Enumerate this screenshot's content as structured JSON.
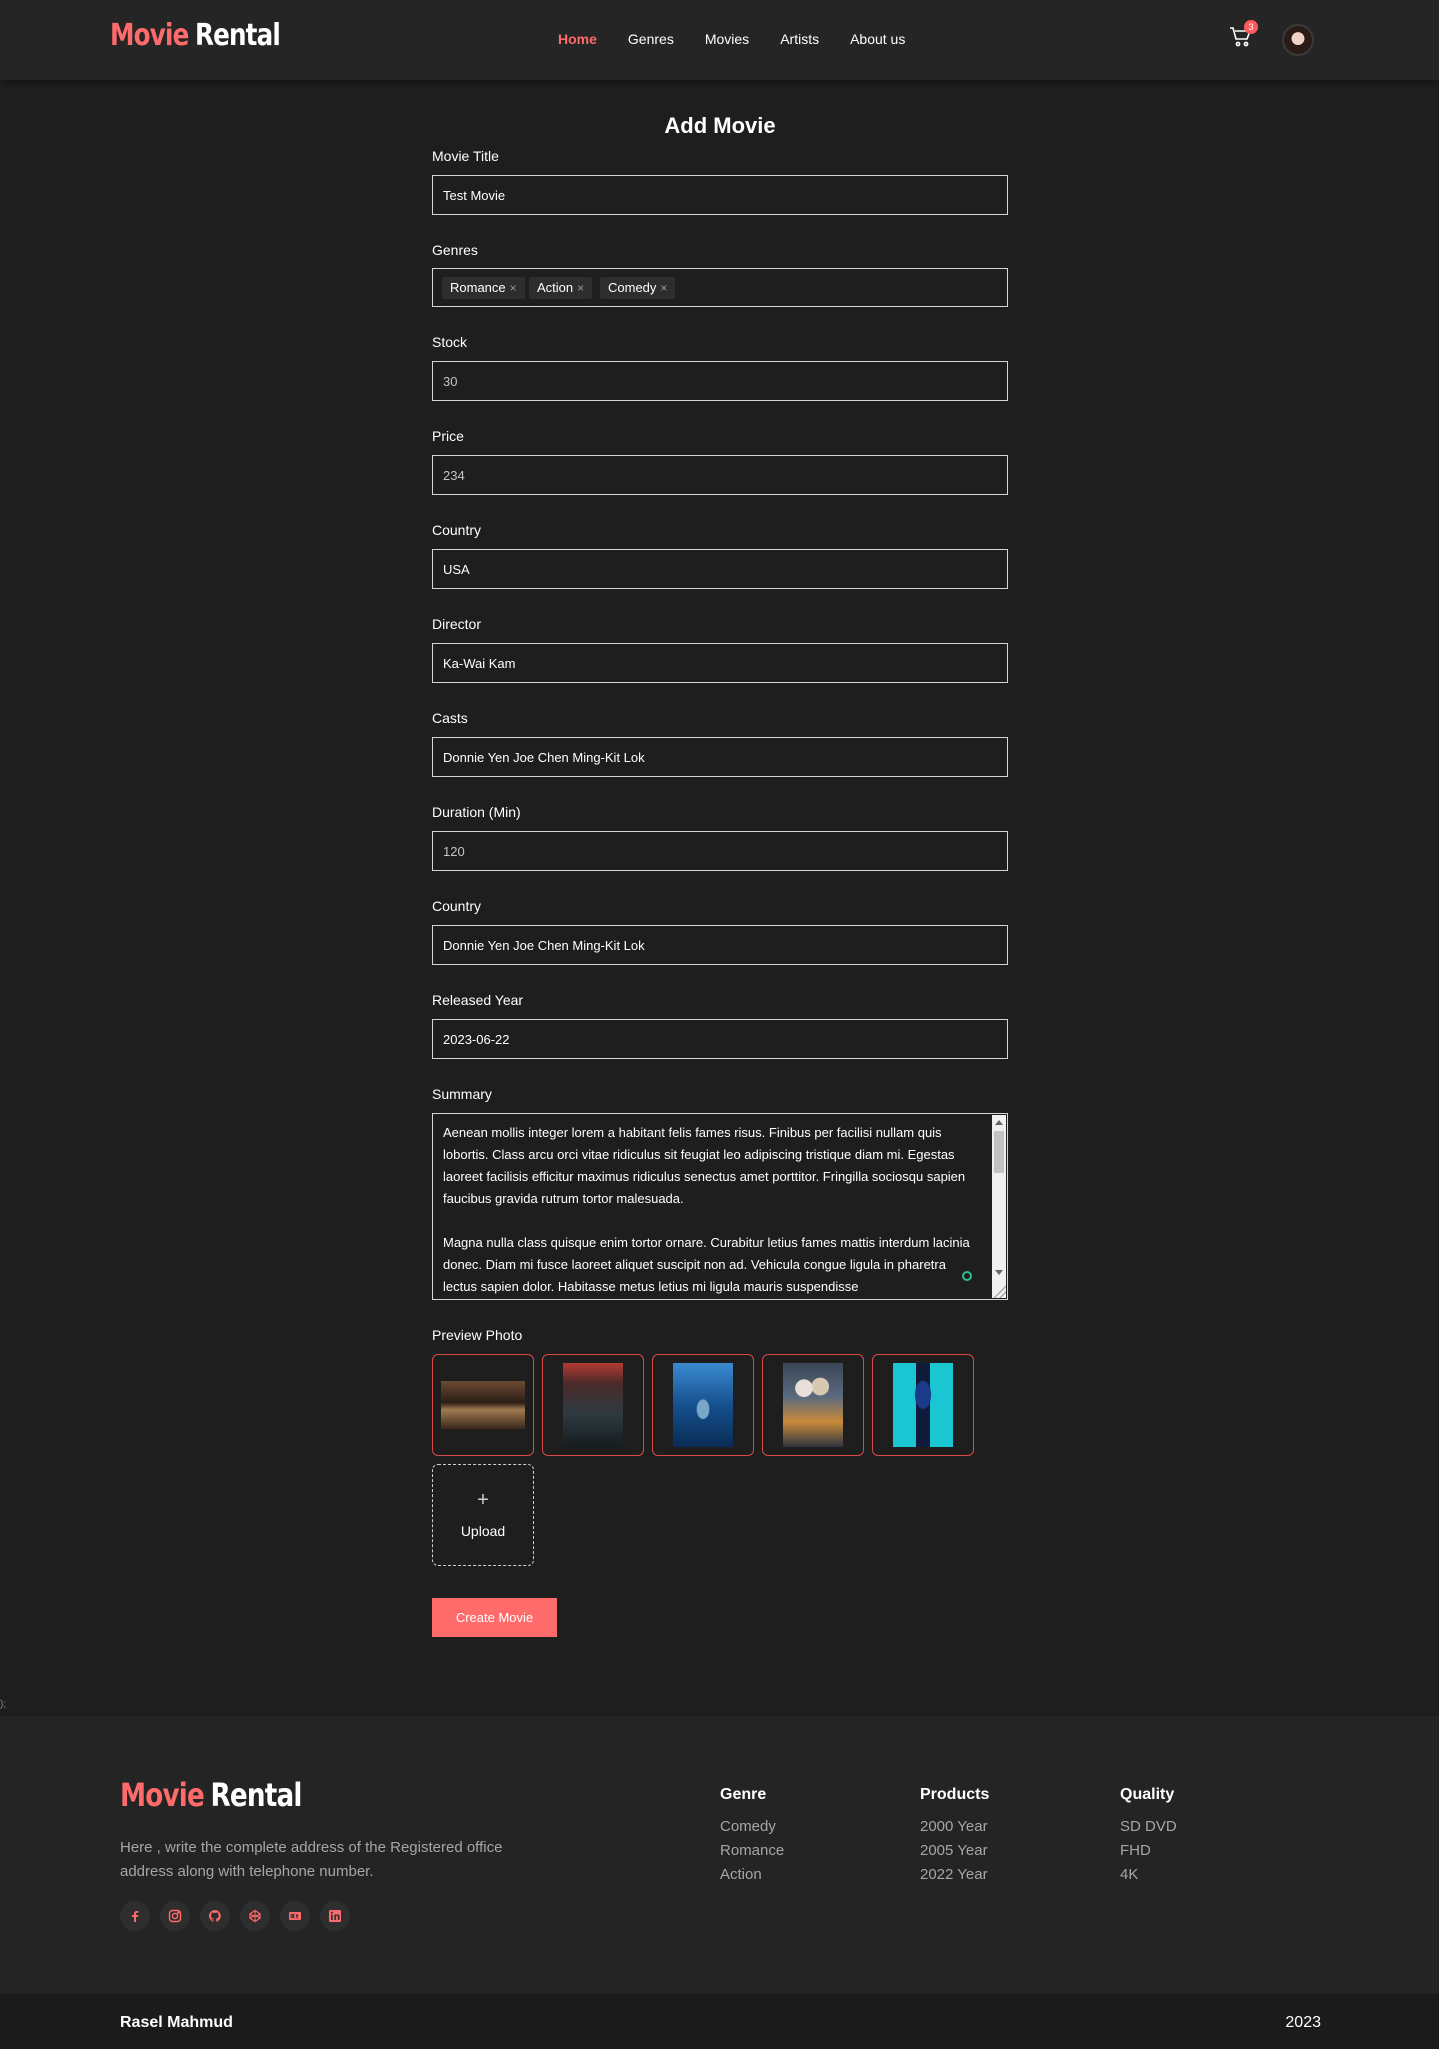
{
  "brand": {
    "name_part1": "Movie",
    "name_part2": "Rental",
    "accent_color": "#ff6b6b"
  },
  "nav": {
    "items": [
      {
        "label": "Home",
        "active": true
      },
      {
        "label": "Genres",
        "active": false
      },
      {
        "label": "Movies",
        "active": false
      },
      {
        "label": "Artists",
        "active": false
      },
      {
        "label": "About us",
        "active": false
      }
    ],
    "cart_icon": "cart-icon",
    "cart_count": "3",
    "avatar_icon": "user-avatar"
  },
  "form": {
    "title": "Add Movie",
    "movie_title": {
      "label": "Movie Title",
      "value": "Test Movie"
    },
    "genres": {
      "label": "Genres",
      "tags": [
        "Romance",
        "Action",
        "Comedy"
      ],
      "remove_icon": "close-icon"
    },
    "stock": {
      "label": "Stock",
      "value": "30"
    },
    "price": {
      "label": "Price",
      "value": "234"
    },
    "country": {
      "label": "Country",
      "value": "USA"
    },
    "director": {
      "label": "Director",
      "value": "Ka-Wai Kam"
    },
    "casts": {
      "label": "Casts",
      "value": "Donnie Yen Joe Chen Ming-Kit Lok"
    },
    "duration": {
      "label": "Duration (Min)",
      "value": "120"
    },
    "country2": {
      "label": "Country",
      "value": "Donnie Yen Joe Chen Ming-Kit Lok"
    },
    "released_year": {
      "label": "Released Year",
      "value": "2023-06-22"
    },
    "summary": {
      "label": "Summary",
      "paragraph1": "Aenean mollis integer lorem a habitant felis fames risus. Finibus per facilisi nullam quis lobortis. Class arcu orci vitae ridiculus sit feugiat leo adipiscing tristique diam mi. Egestas laoreet facilisis efficitur maximus ridiculus senectus amet porttitor. Fringilla sociosqu sapien faucibus gravida rutrum tortor malesuada.",
      "paragraph2": "Magna nulla class quisque enim tortor ornare. Curabitur letius fames mattis interdum lacinia donec. Diam mi fusce laoreet aliquet suscipit non ad. Vehicula congue ligula in pharetra lectus sapien dolor. Habitasse metus letius mi ligula mauris suspendisse"
    },
    "preview_photo": {
      "label": "Preview Photo",
      "photos": [
        "photo-hall",
        "photo-city-street",
        "photo-shark",
        "photo-anime-couple",
        "photo-blue-hand"
      ]
    },
    "upload": {
      "icon": "plus-icon",
      "label": "Upload"
    },
    "submit_label": "Create Movie"
  },
  "stray_text": ");",
  "footer": {
    "description": "Here , write the complete address of the Registered office address along with telephone number.",
    "socials": [
      "facebook-icon",
      "instagram-icon",
      "github-icon",
      "codepen-icon",
      "dev-icon",
      "linkedin-icon"
    ],
    "columns": [
      {
        "title": "Genre",
        "items": [
          "Comedy",
          "Romance",
          "Action"
        ]
      },
      {
        "title": "Products",
        "items": [
          "2000 Year",
          "2005 Year",
          "2022 Year"
        ]
      },
      {
        "title": "Quality",
        "items": [
          "SD DVD",
          "FHD",
          "4K"
        ]
      }
    ],
    "author": "Rasel Mahmud",
    "year": "2023"
  }
}
